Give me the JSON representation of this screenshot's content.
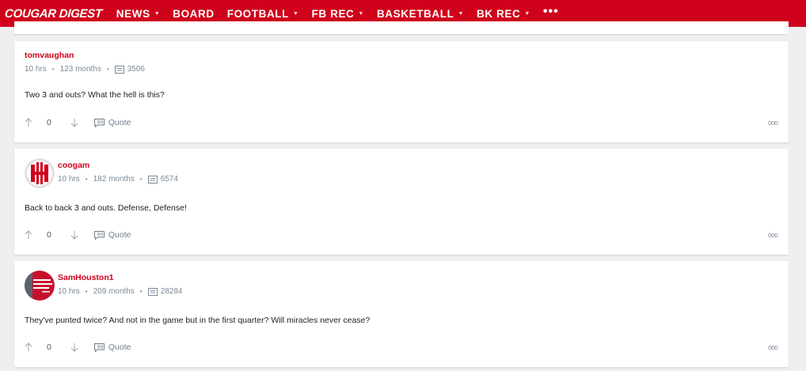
{
  "header": {
    "logo": "COUGAR DIGEST",
    "nav": [
      {
        "label": "NEWS",
        "caret": true
      },
      {
        "label": "BOARD",
        "caret": false
      },
      {
        "label": "FOOTBALL",
        "caret": true
      },
      {
        "label": "FB REC",
        "caret": true
      },
      {
        "label": "BASKETBALL",
        "caret": true
      },
      {
        "label": "BK REC",
        "caret": true
      }
    ],
    "more": "•••"
  },
  "posts": [
    {
      "username": "tomvaughan",
      "time": "10 hrs",
      "tenure": "123 months",
      "post_count": "3506",
      "body": "Two 3 and outs? What the hell is this?",
      "score": "0",
      "quote_label": "Quote",
      "avatar": null
    },
    {
      "username": "coogam",
      "time": "10 hrs",
      "tenure": "182 months",
      "post_count": "6574",
      "body": "Back to back 3 and outs. Defense, Defense!",
      "score": "0",
      "quote_label": "Quote",
      "avatar": "uh-logo"
    },
    {
      "username": "SamHouston1",
      "time": "10 hrs",
      "tenure": "209 months",
      "post_count": "28284",
      "body": "They've punted twice? And not in the game but in the first quarter? Will miracles never cease?",
      "score": "0",
      "quote_label": "Quote",
      "avatar": "red-photo"
    }
  ],
  "more_icon": "ooo",
  "colors": {
    "brand": "#d0021b",
    "meta": "#7a8a99"
  }
}
